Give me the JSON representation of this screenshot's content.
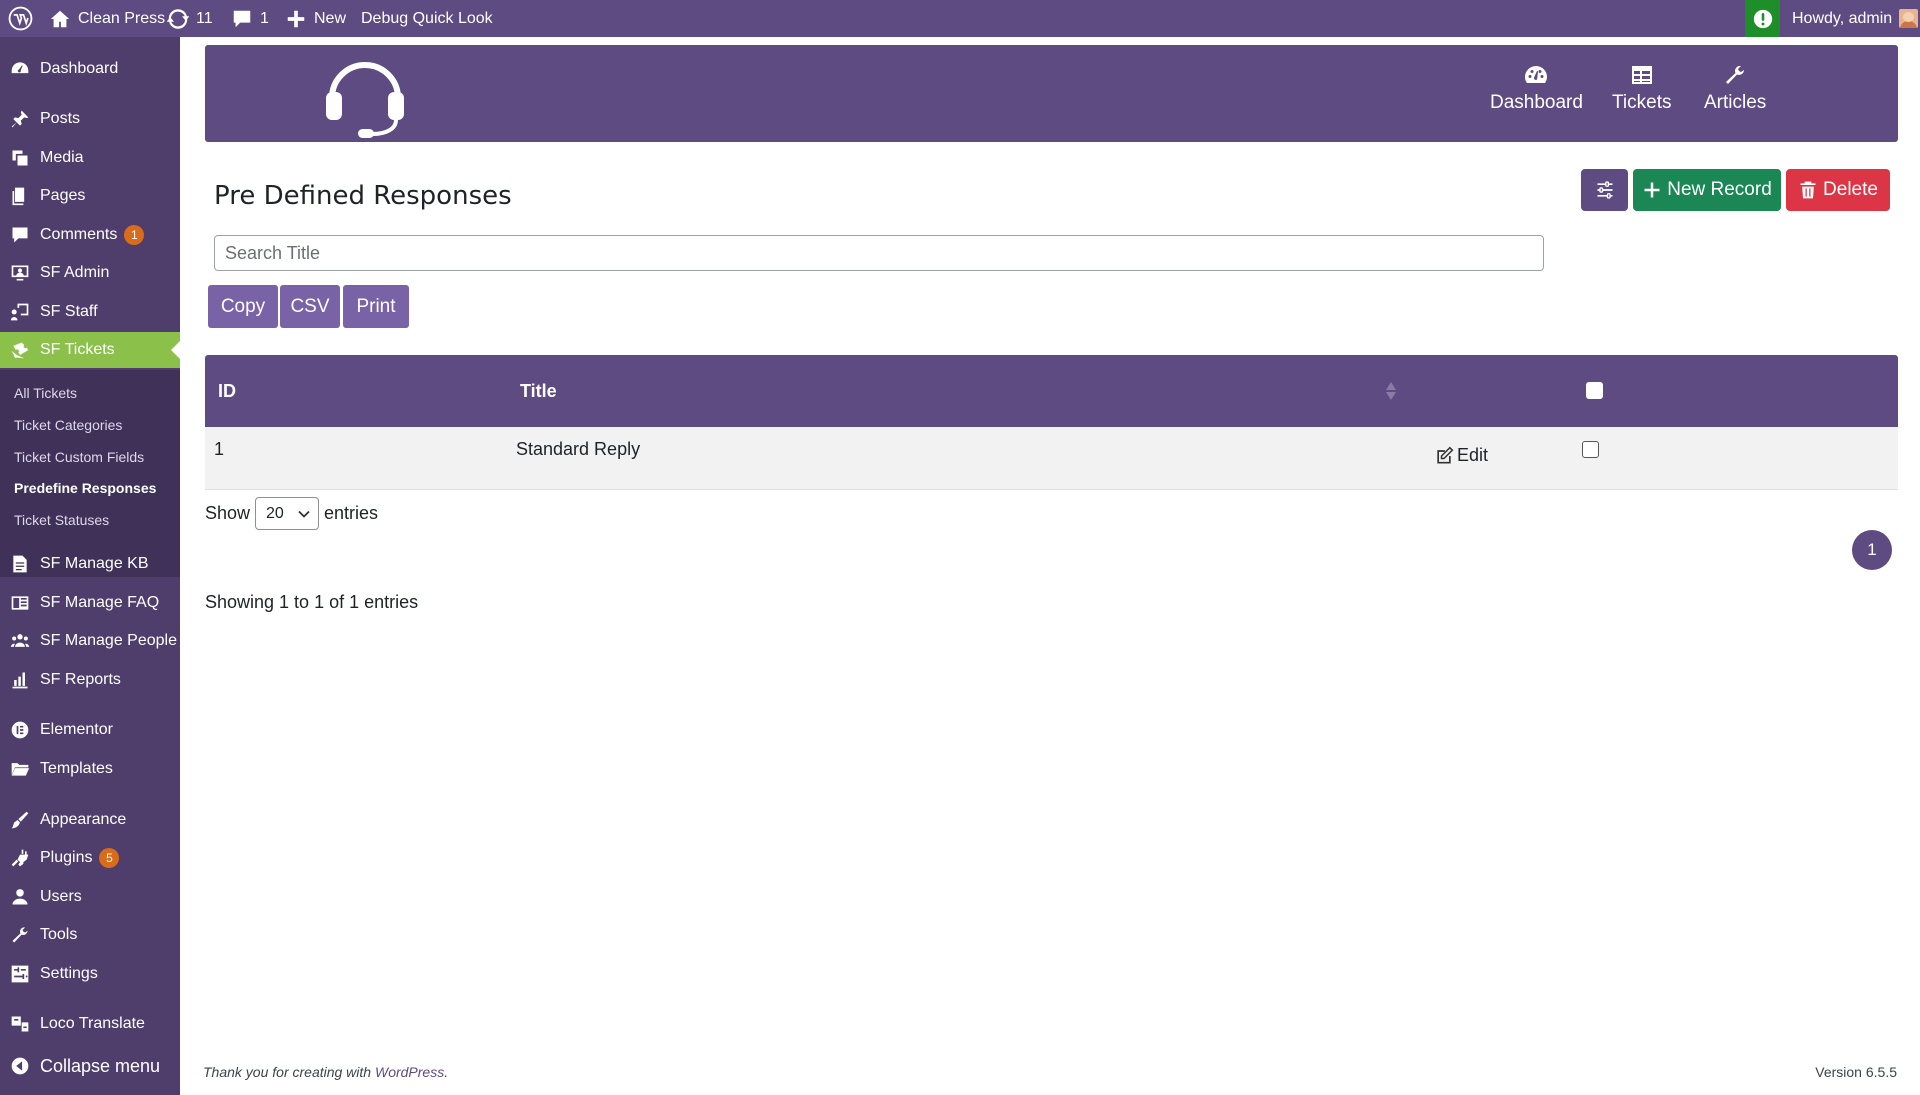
{
  "adminbar": {
    "site_name": "Clean Press",
    "updates_count": "11",
    "comments_count": "1",
    "new_label": "New",
    "debug_label": "Debug Quick Look",
    "greeting": "Howdy, admin"
  },
  "sidebar": {
    "dashboard": "Dashboard",
    "posts": "Posts",
    "media": "Media",
    "pages": "Pages",
    "comments": "Comments",
    "comments_badge": "1",
    "sf_admin": "SF Admin",
    "sf_staff": "SF Staff",
    "sf_tickets": "SF Tickets",
    "sub": {
      "all_tickets": "All Tickets",
      "ticket_categories": "Ticket Categories",
      "ticket_custom_fields": "Ticket Custom Fields",
      "predefine_responses": "Predefine Responses",
      "ticket_statuses": "Ticket Statuses"
    },
    "sf_manage_kb": "SF Manage KB",
    "sf_manage_faq": "SF Manage FAQ",
    "sf_manage_people": "SF Manage People",
    "sf_reports": "SF Reports",
    "elementor": "Elementor",
    "templates": "Templates",
    "appearance": "Appearance",
    "plugins": "Plugins",
    "plugins_badge": "5",
    "users": "Users",
    "tools": "Tools",
    "settings": "Settings",
    "loco_translate": "Loco Translate",
    "collapse": "Collapse menu"
  },
  "banner": {
    "nav_dashboard": "Dashboard",
    "nav_tickets": "Tickets",
    "nav_articles": "Articles"
  },
  "page": {
    "title": "Pre Defined Responses",
    "new_record": "New Record",
    "delete": "Delete",
    "search_placeholder": "Search Title"
  },
  "export": {
    "copy": "Copy",
    "csv": "CSV",
    "print": "Print"
  },
  "table": {
    "columns": {
      "id": "ID",
      "title": "Title"
    },
    "rows": [
      {
        "id": "1",
        "title": "Standard Reply",
        "action": "Edit"
      }
    ]
  },
  "length": {
    "show": "Show",
    "value": "20",
    "entries": "entries"
  },
  "pagination": {
    "current": "1"
  },
  "info": "Showing 1 to 1 of 1 entries",
  "footer": {
    "thanks_prefix": "Thank you for creating with ",
    "thanks_link": "WordPress",
    "thanks_suffix": ".",
    "version": "Version 6.5.5"
  },
  "colors": {
    "brand_purple": "#5e4b82",
    "sidebar_bg": "#4f3e6b",
    "active_menu": "#8bc04b",
    "success": "#1a8754",
    "danger": "#dc3545",
    "badge": "#d86c1a"
  }
}
